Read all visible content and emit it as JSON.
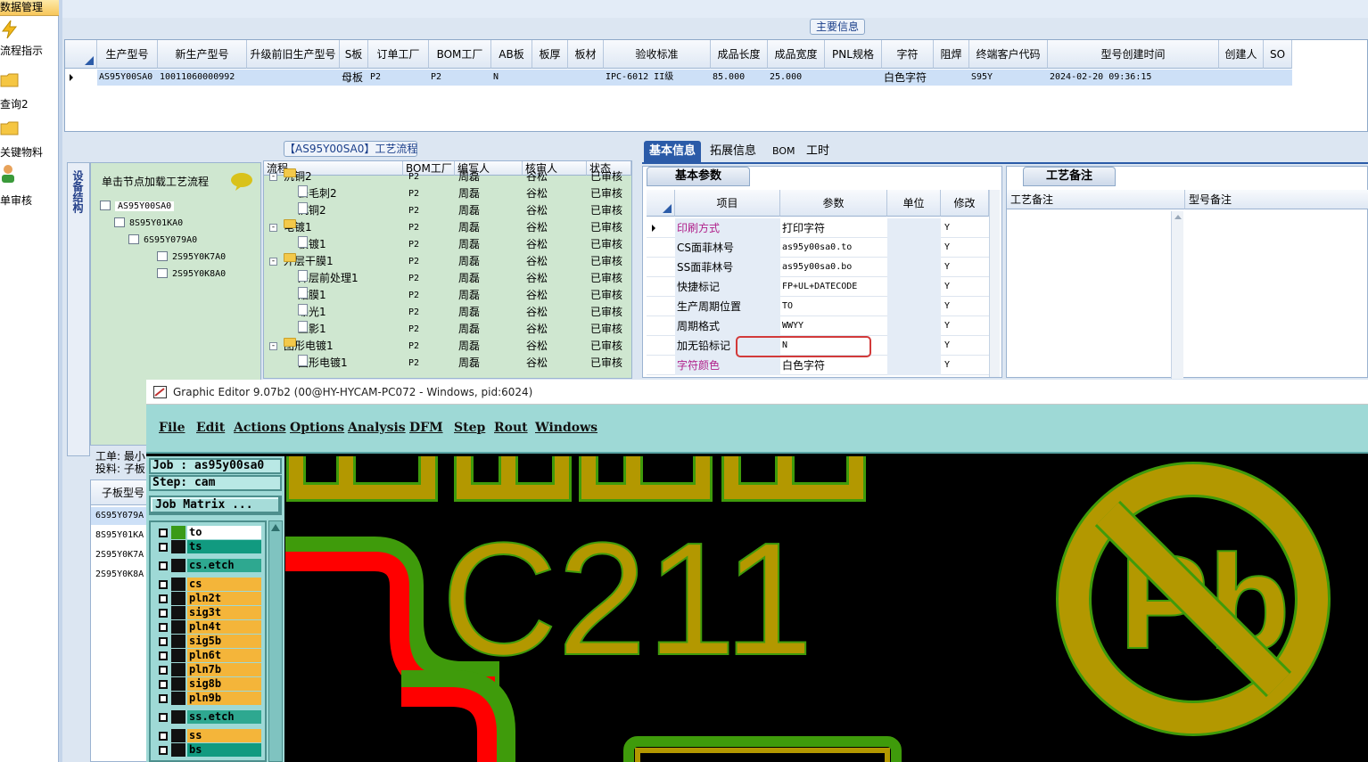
{
  "nav": {
    "header": "数据管理",
    "items": [
      {
        "label": "流程指示",
        "icon": "lightning-icon"
      },
      {
        "label": "查询2",
        "icon": "folder-icon"
      },
      {
        "label": "关键物料",
        "icon": "folder-icon"
      },
      {
        "label": "单审核",
        "icon": "user-icon"
      }
    ]
  },
  "main_info": {
    "title": "主要信息",
    "columns": [
      "生产型号",
      "新生产型号",
      "升级前旧生产型号",
      "S板",
      "订单工厂",
      "BOM工厂",
      "AB板",
      "板厚",
      "板材",
      "验收标准",
      "成品长度",
      "成品宽度",
      "PNL规格",
      "字符",
      "阻焊",
      "终端客户代码",
      "型号创建时间",
      "创建人",
      "SO"
    ],
    "row": [
      "AS95Y00SA0",
      "10011060000992",
      "",
      "母板",
      "P2",
      "P2",
      "N",
      "",
      "",
      "IPC-6012 II级",
      "85.000",
      "25.000",
      "",
      "白色字符",
      "",
      "S95Y",
      "2024-02-20 09:36:15",
      "",
      ""
    ]
  },
  "process_panel": {
    "title": "【AS95Y00SA0】工艺流程",
    "vertical_tab": "设备结构",
    "hint": "单击节点加载工艺流程",
    "tree": [
      "AS95Y00SA0",
      "8S95Y01KA0",
      "6S95Y079A0",
      "2S95Y0K7A0",
      "2S95Y0K8A0"
    ],
    "flow_columns": [
      "流程",
      "BOM工厂",
      "编写人",
      "核审人",
      "状态"
    ],
    "flow_rows": [
      {
        "name": "沉铜2",
        "level": 0,
        "type": "folder",
        "factory": "P2",
        "writer": "周磊",
        "reviewer": "谷松",
        "status": "已审核"
      },
      {
        "name": "去毛刺2",
        "level": 1,
        "type": "doc",
        "factory": "P2",
        "writer": "周磊",
        "reviewer": "谷松",
        "status": "已审核"
      },
      {
        "name": "沉铜2",
        "level": 1,
        "type": "doc",
        "factory": "P2",
        "writer": "周磊",
        "reviewer": "谷松",
        "status": "已审核"
      },
      {
        "name": "电镀1",
        "level": 0,
        "type": "folder",
        "factory": "P2",
        "writer": "周磊",
        "reviewer": "谷松",
        "status": "已审核"
      },
      {
        "name": "板镀1",
        "level": 1,
        "type": "doc",
        "factory": "P2",
        "writer": "周磊",
        "reviewer": "谷松",
        "status": "已审核"
      },
      {
        "name": "外层干膜1",
        "level": 0,
        "type": "folder",
        "factory": "P2",
        "writer": "周磊",
        "reviewer": "谷松",
        "status": "已审核"
      },
      {
        "name": "外层前处理1",
        "level": 1,
        "type": "doc",
        "factory": "P2",
        "writer": "周磊",
        "reviewer": "谷松",
        "status": "已审核"
      },
      {
        "name": "贴膜1",
        "level": 1,
        "type": "doc",
        "factory": "P2",
        "writer": "周磊",
        "reviewer": "谷松",
        "status": "已审核"
      },
      {
        "name": "曝光1",
        "level": 1,
        "type": "doc",
        "factory": "P2",
        "writer": "周磊",
        "reviewer": "谷松",
        "status": "已审核"
      },
      {
        "name": "显影1",
        "level": 1,
        "type": "doc",
        "factory": "P2",
        "writer": "周磊",
        "reviewer": "谷松",
        "status": "已审核"
      },
      {
        "name": "图形电镀1",
        "level": 0,
        "type": "folder",
        "factory": "P2",
        "writer": "周磊",
        "reviewer": "谷松",
        "status": "已审核"
      },
      {
        "name": "图形电镀1",
        "level": 1,
        "type": "doc",
        "factory": "P2",
        "writer": "周磊",
        "reviewer": "谷松",
        "status": "已审核"
      }
    ],
    "lower_text": [
      "工单: 最小",
      "投料: 子板"
    ],
    "sub_header": "子板型号",
    "sub_rows": [
      "6S95Y079A",
      "8S95Y01KA",
      "2S95Y0K7A",
      "2S95Y0K8A"
    ]
  },
  "right_tabs": [
    "基本信息",
    "拓展信息",
    "BOM",
    "工时"
  ],
  "basic": {
    "subtab": "基本参数",
    "columns": [
      "项目",
      "参数",
      "单位",
      "修改"
    ],
    "rows": [
      {
        "item": "印刷方式",
        "param": "打印字符",
        "unit": "",
        "mod": "Y",
        "pink": true
      },
      {
        "item": "CS面菲林号",
        "param": "as95y00sa0.to",
        "unit": "",
        "mod": "Y",
        "pink": false
      },
      {
        "item": "SS面菲林号",
        "param": "as95y00sa0.bo",
        "unit": "",
        "mod": "Y",
        "pink": false
      },
      {
        "item": "快捷标记",
        "param": "FP+UL+DATECODE",
        "unit": "",
        "mod": "Y",
        "pink": false
      },
      {
        "item": "生产周期位置",
        "param": "TO",
        "unit": "",
        "mod": "Y",
        "pink": false
      },
      {
        "item": "周期格式",
        "param": "WWYY",
        "unit": "",
        "mod": "Y",
        "pink": false
      },
      {
        "item": "加无铅标记",
        "param": "N",
        "unit": "",
        "mod": "Y",
        "pink": false
      },
      {
        "item": "字符颜色",
        "param": "白色字符",
        "unit": "",
        "mod": "Y",
        "pink": true
      }
    ]
  },
  "memo": {
    "tab": "工艺备注",
    "col1": "工艺备注",
    "col2": "型号备注"
  },
  "graphic_editor": {
    "title": "Graphic Editor 9.07b2 (00@HY-HYCAM-PC072 - Windows, pid:6024)",
    "menus": [
      "File",
      "Edit",
      "Actions",
      "Options",
      "Analysis",
      "DFM",
      "Step",
      "Rout",
      "Windows"
    ],
    "job": "Job : as95y00sa0",
    "step": "Step: cam",
    "matrix_button": "Job Matrix ...",
    "layers": [
      {
        "name": "to",
        "color": "#ffffff",
        "swatch": "#3a9a18"
      },
      {
        "name": "ts",
        "color": "#119a80",
        "swatch": "#111111"
      },
      {
        "name": "cs.etch",
        "color": "#2ea890",
        "swatch": "#111111"
      },
      {
        "name": "cs",
        "color": "#f4b53a",
        "swatch": "#111111"
      },
      {
        "name": "pln2t",
        "color": "#f4b53a",
        "swatch": "#111111"
      },
      {
        "name": "sig3t",
        "color": "#f4b53a",
        "swatch": "#111111"
      },
      {
        "name": "pln4t",
        "color": "#f4b53a",
        "swatch": "#111111"
      },
      {
        "name": "sig5b",
        "color": "#f4b53a",
        "swatch": "#111111"
      },
      {
        "name": "pln6t",
        "color": "#f4b53a",
        "swatch": "#111111"
      },
      {
        "name": "pln7b",
        "color": "#f4b53a",
        "swatch": "#111111"
      },
      {
        "name": "sig8b",
        "color": "#f4b53a",
        "swatch": "#111111"
      },
      {
        "name": "pln9b",
        "color": "#f4b53a",
        "swatch": "#111111"
      },
      {
        "name": "ss.etch",
        "color": "#2ea890",
        "swatch": "#111111"
      },
      {
        "name": "ss",
        "color": "#f4b53a",
        "swatch": "#111111"
      },
      {
        "name": "bs",
        "color": "#119a80",
        "swatch": "#111111"
      }
    ],
    "canvas_text": "C211",
    "pb_text": "Pb",
    "colors": {
      "gold": "#b39800",
      "green": "#3f9b0b",
      "red": "#ff0000"
    }
  }
}
